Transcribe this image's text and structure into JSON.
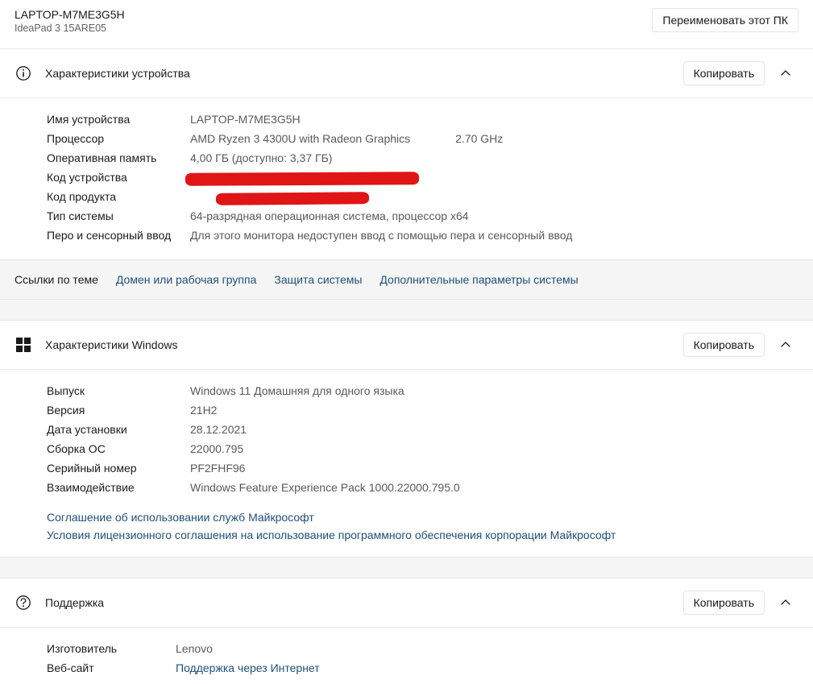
{
  "header": {
    "device_name": "LAPTOP-M7ME3G5H",
    "device_model": "IdeaPad 3 15ARE05",
    "rename_button": "Переименовать этот ПК"
  },
  "device_spec": {
    "title": "Характеристики устройства",
    "copy": "Копировать",
    "rows": {
      "name_label": "Имя устройства",
      "name_value": "LAPTOP-M7ME3G5H",
      "cpu_label": "Процессор",
      "cpu_value": "AMD Ryzen 3 4300U with Radeon Graphics",
      "cpu_freq": "2.70 GHz",
      "ram_label": "Оперативная память",
      "ram_value": "4,00 ГБ (доступно: 3,37 ГБ)",
      "device_id_label": "Код устройства",
      "product_id_label": "Код продукта",
      "system_type_label": "Тип системы",
      "system_type_value": "64-разрядная операционная система, процессор x64",
      "pen_label": "Перо и сенсорный ввод",
      "pen_value": "Для этого монитора недоступен ввод с помощью пера и сенсорный ввод"
    }
  },
  "related": {
    "title": "Ссылки по теме",
    "link1": "Домен или рабочая группа",
    "link2": "Защита системы",
    "link3": "Дополнительные параметры системы"
  },
  "windows_spec": {
    "title": "Характеристики Windows",
    "copy": "Копировать",
    "rows": {
      "edition_label": "Выпуск",
      "edition_value": "Windows 11 Домашняя для одного языка",
      "version_label": "Версия",
      "version_value": "21H2",
      "install_date_label": "Дата установки",
      "install_date_value": "28.12.2021",
      "build_label": "Сборка ОС",
      "build_value": "22000.795",
      "serial_label": "Серийный номер",
      "serial_value": "PF2FHF96",
      "experience_label": "Взаимодействие",
      "experience_value": "Windows Feature Experience Pack 1000.22000.795.0"
    },
    "links": {
      "terms": "Соглашение об использовании служб Майкрософт",
      "license": "Условия лицензионного соглашения на использование программного обеспечения корпорации Майкрософт"
    }
  },
  "support": {
    "title": "Поддержка",
    "copy": "Копировать",
    "rows": {
      "manufacturer_label": "Изготовитель",
      "manufacturer_value": "Lenovo",
      "website_label": "Веб-сайт",
      "website_value": "Поддержка через Интернет"
    }
  }
}
